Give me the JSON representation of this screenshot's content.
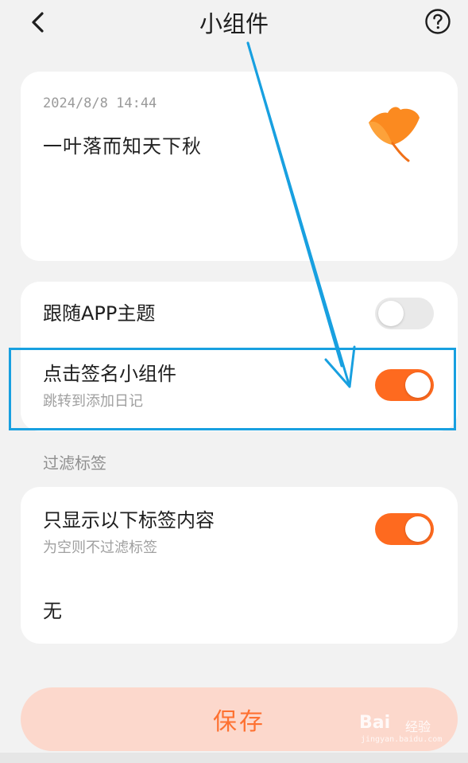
{
  "header": {
    "title": "小组件",
    "back_icon": "chevron-left-icon",
    "help_icon": "question-circle-icon"
  },
  "widget_preview": {
    "date": "2024/8/8 14:44",
    "quote": "一叶落而知天下秋",
    "image_icon": "ginkgo-leaf-icon"
  },
  "settings": {
    "follow_theme": {
      "title": "跟随APP主题",
      "enabled": false
    },
    "click_widget": {
      "title": "点击签名小组件",
      "subtitle": "跳转到添加日记",
      "enabled": true
    }
  },
  "filter": {
    "section_label": "过滤标签",
    "show_tags": {
      "title": "只显示以下标签内容",
      "subtitle": "为空则不过滤标签",
      "enabled": true
    },
    "tags_value": "无"
  },
  "save_button": {
    "label": "保存"
  },
  "watermark": {
    "brand": "Bai",
    "brand_cn": "经验",
    "url": "jingyan.baidu.com"
  },
  "colors": {
    "accent": "#fe6a1f",
    "save_bg": "#fcd8cc",
    "annotation": "#18a0e0",
    "background": "#f2f2f2"
  }
}
